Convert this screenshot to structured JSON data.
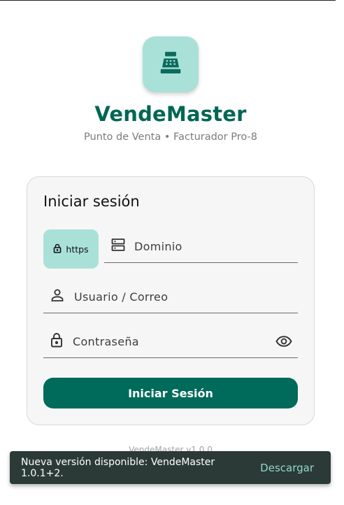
{
  "app": {
    "title": "VendeMaster",
    "subtitle": "Punto de Venta • Facturador Pro-8",
    "logo_icon": "cash-register-icon",
    "accent_color": "#006654",
    "logo_bg_color": "#a9e1d9"
  },
  "login": {
    "heading": "Iniciar sesión",
    "protocol_chip": "https",
    "domain_label": "Dominio",
    "user_label": "Usuario / Correo",
    "password_label": "Contraseña",
    "submit_label": "Iniciar Sesión",
    "icons": {
      "protocol": "lock-icon",
      "domain": "server-icon",
      "user": "person-icon",
      "password": "lock-icon",
      "visibility": "eye-icon"
    }
  },
  "footer": {
    "version": "VendeMaster v1.0.0"
  },
  "snackbar": {
    "message": "Nueva versión disponible: VendeMaster 1.0.1+2.",
    "action": "Descargar"
  }
}
